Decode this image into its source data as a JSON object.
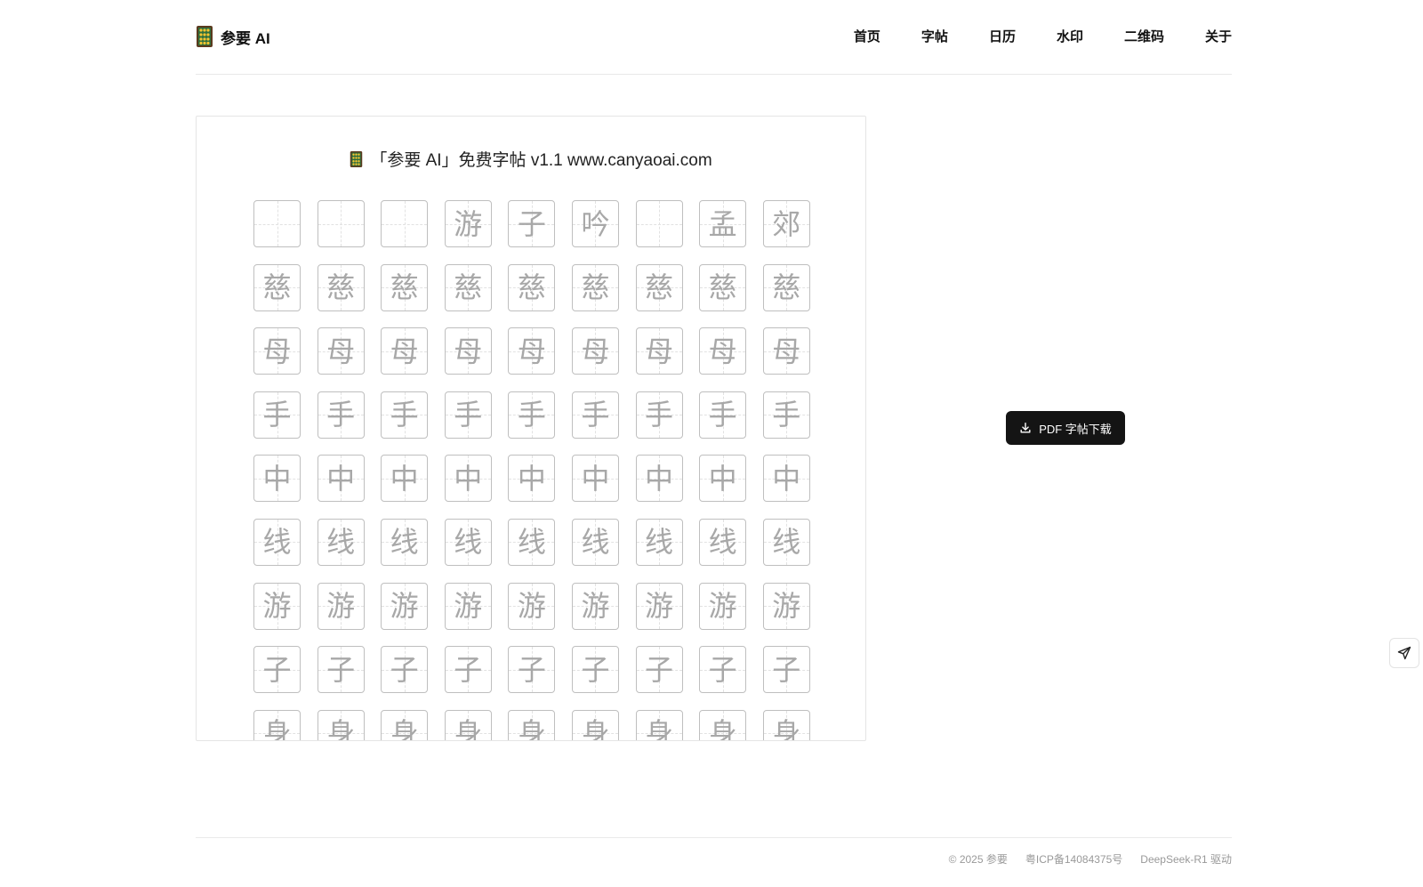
{
  "header": {
    "brand": {
      "icon": "abacus-icon",
      "name": "参要 AI"
    },
    "nav": [
      "首页",
      "字帖",
      "日历",
      "水印",
      "二维码",
      "关于"
    ]
  },
  "sheet": {
    "title_icon": "abacus-icon",
    "title": "「参要 AI」免费字帖 v1.1 www.canyaoai.com",
    "rows": [
      [
        "",
        "",
        "",
        "游",
        "子",
        "吟",
        "",
        "孟",
        "郊"
      ],
      [
        "慈",
        "慈",
        "慈",
        "慈",
        "慈",
        "慈",
        "慈",
        "慈",
        "慈"
      ],
      [
        "母",
        "母",
        "母",
        "母",
        "母",
        "母",
        "母",
        "母",
        "母"
      ],
      [
        "手",
        "手",
        "手",
        "手",
        "手",
        "手",
        "手",
        "手",
        "手"
      ],
      [
        "中",
        "中",
        "中",
        "中",
        "中",
        "中",
        "中",
        "中",
        "中"
      ],
      [
        "线",
        "线",
        "线",
        "线",
        "线",
        "线",
        "线",
        "线",
        "线"
      ],
      [
        "游",
        "游",
        "游",
        "游",
        "游",
        "游",
        "游",
        "游",
        "游"
      ],
      [
        "子",
        "子",
        "子",
        "子",
        "子",
        "子",
        "子",
        "子",
        "子"
      ],
      [
        "身",
        "身",
        "身",
        "身",
        "身",
        "身",
        "身",
        "身",
        "身"
      ]
    ]
  },
  "download": {
    "icon": "download-icon",
    "label": "PDF 字帖下载"
  },
  "float": {
    "icon": "send-icon"
  },
  "footer": {
    "copyright": "© 2025 参要",
    "icp": "粤ICP备14084375号",
    "powered": "DeepSeek-R1 驱动"
  },
  "colors": {
    "accent": "#141414",
    "glyph": "#a8a8a8",
    "border": "#bfbfbf"
  }
}
